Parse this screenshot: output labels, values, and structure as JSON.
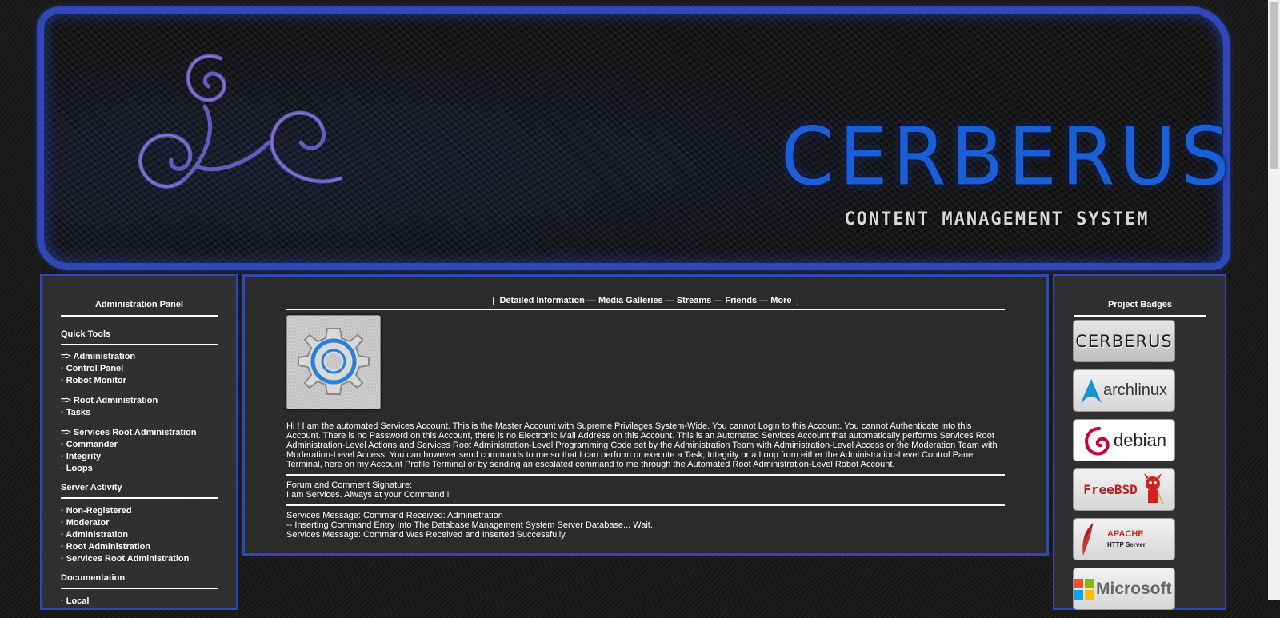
{
  "banner": {
    "title": "CERBERUS",
    "subtitle": "CONTENT MANAGEMENT SYSTEM",
    "accent_color": "#2f47b7"
  },
  "left_panel": {
    "title": "Administration Panel",
    "sections": [
      {
        "title": "Quick Tools",
        "groups": [
          [
            "=> Administration",
            "· Control Panel",
            "· Robot Monitor"
          ],
          [
            "=> Root Administration",
            "· Tasks"
          ],
          [
            "=> Services Root Administration",
            "· Commander",
            "· Integrity",
            "· Loops"
          ]
        ]
      },
      {
        "title": "Server Activity",
        "groups": [
          [
            "· Non-Registered",
            "· Moderator",
            "· Administration",
            "· Root Administration",
            "· Services Root Administration"
          ]
        ]
      },
      {
        "title": "Documentation",
        "groups": [
          [
            "· Local"
          ]
        ]
      }
    ]
  },
  "center": {
    "tabs": {
      "open_bracket": "[",
      "close_bracket": "]",
      "separator": "—",
      "items": [
        "Detailed Information",
        "Media Galleries",
        "Streams",
        "Friends",
        "More"
      ]
    },
    "avatar_icon": "gear-avatar-icon",
    "bio": "Hi ! I am the automated Services Account. This is the Master Account with Supreme Privileges System-Wide. You cannot Login to this Account. You cannot Authenticate into this Account. There is no Password on this Account, there is no Electronic Mail Address on this Account. This is an Automated Services Account that automatically performs Services Root Administration-Level Actions and Services Root Administration-Level Programming Code set by the Administration Team with Administration-Level Access or the Moderation Team with Moderation-Level Access. You can however send commands to me so that I can perform or execute a Task, Integrity or a Loop from either the Administration-Level Control Panel Terminal, here on my Account Profile Terminal or by sending an escalated command to me through the Automated Root Administration-Level Robot Account.",
    "signature_label": "Forum and Comment Signature:",
    "signature_text": "I am Services. Always at your Command !",
    "messages": [
      "Services Message: Command Received: Administration",
      "-- Inserting Command Entry Into The Database Management System Server Database... Wait.",
      "Services Message: Command Was Received and Inserted Successfully."
    ]
  },
  "right_panel": {
    "title": "Project Badges",
    "badges": [
      {
        "name": "cerberus-badge",
        "label": "CERBERUS"
      },
      {
        "name": "archlinux-badge",
        "label": "archlinux"
      },
      {
        "name": "debian-badge",
        "label": "debian"
      },
      {
        "name": "freebsd-badge",
        "label": "FreeBSD"
      },
      {
        "name": "apache-badge",
        "label": "APACHE",
        "sublabel": "HTTP Server"
      },
      {
        "name": "microsoft-badge",
        "label": "Microsoft"
      }
    ]
  }
}
